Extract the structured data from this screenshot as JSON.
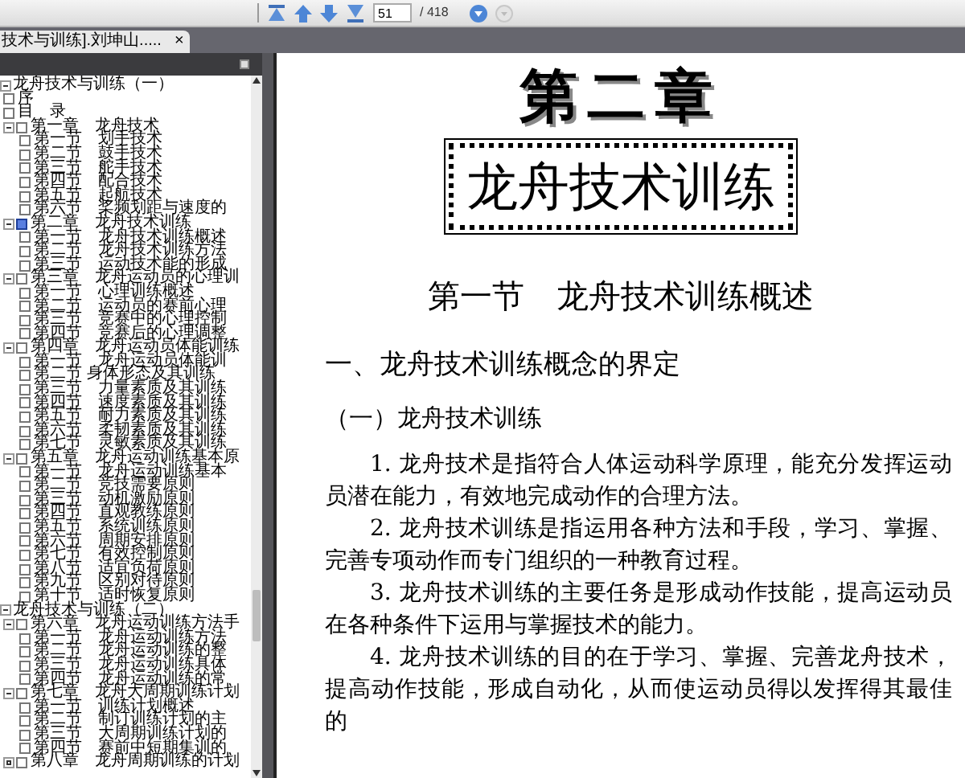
{
  "toolbar": {
    "page_number": "51",
    "page_total": "/ 418"
  },
  "tab": {
    "title": "技术与训练].刘坤山.....",
    "close": "×"
  },
  "outline": [
    {
      "label": "龙舟技术与训练（一）",
      "expanded": true,
      "children": [
        {
          "label": "序",
          "selected": false
        },
        {
          "label": "目　录",
          "selected": false
        },
        {
          "label": "第一章　龙舟技术",
          "selected": false,
          "expanded": true,
          "children": [
            {
              "label": "第一节　划手技术",
              "selected": false
            },
            {
              "label": "第二节　鼓手技术",
              "selected": false
            },
            {
              "label": "第三节　舵手技术",
              "selected": false
            },
            {
              "label": "第四节　配合技术",
              "selected": false
            },
            {
              "label": "第五节　起航技术",
              "selected": false
            },
            {
              "label": "第六节　桨频划距与速度的",
              "selected": false
            }
          ]
        },
        {
          "label": "第二章　龙舟技术训练",
          "selected": true,
          "expanded": true,
          "children": [
            {
              "label": "第一节　龙舟技术训练概述",
              "selected": false
            },
            {
              "label": "第二节　龙舟技术训练方法",
              "selected": false
            },
            {
              "label": "第三节　运动技术能的形成",
              "selected": false
            }
          ]
        },
        {
          "label": "第三章　龙舟运动员的心理训",
          "selected": false,
          "expanded": true,
          "children": [
            {
              "label": "第一节　心理训练概述",
              "selected": false
            },
            {
              "label": "第二节　运动员的赛前心理",
              "selected": false
            },
            {
              "label": "第三节　竞赛中的心理控制",
              "selected": false
            },
            {
              "label": "第四节　竞赛后的心理调整",
              "selected": false
            }
          ]
        },
        {
          "label": "第四章　龙舟运动员体能训练",
          "selected": false,
          "expanded": true,
          "children": [
            {
              "label": "第一节　龙舟运动员体能训",
              "selected": false
            },
            {
              "label": "第二节 身体形态及其训练",
              "selected": false
            },
            {
              "label": "第三节　力量素质及其训练",
              "selected": false
            },
            {
              "label": "第四节　速度素质及其训练",
              "selected": false
            },
            {
              "label": "第五节　耐力素质及其训练",
              "selected": false
            },
            {
              "label": "第六节　柔韧素质及其训练",
              "selected": false
            },
            {
              "label": "第七节　灵敏素质及其训练",
              "selected": false
            }
          ]
        },
        {
          "label": "第五章　龙舟运动训练基本原",
          "selected": false,
          "expanded": true,
          "children": [
            {
              "label": "第一节　龙舟运动训练基本",
              "selected": false
            },
            {
              "label": "第二节　竞技需要原则",
              "selected": false
            },
            {
              "label": "第三节　动机激励原则",
              "selected": false
            },
            {
              "label": "第四节　直观教练原则",
              "selected": false
            },
            {
              "label": "第五节　系统训练原则",
              "selected": false
            },
            {
              "label": "第六节　周期安排原则",
              "selected": false
            },
            {
              "label": "第七节　有效控制原则",
              "selected": false
            },
            {
              "label": "第八节　适宜负荷原则",
              "selected": false
            },
            {
              "label": "第九节　区别对待原则",
              "selected": false
            },
            {
              "label": "第十节　适时恢复原则",
              "selected": false
            }
          ]
        }
      ]
    },
    {
      "label": "龙舟技术与训练（二）",
      "expanded": true,
      "children": [
        {
          "label": "第六章　龙舟运动训练方法手",
          "selected": false,
          "expanded": true,
          "children": [
            {
              "label": "第一节　龙舟运动训练方法",
              "selected": false
            },
            {
              "label": "第二节　龙舟运动训练的整",
              "selected": false
            },
            {
              "label": "第三节　龙舟运动训练具体",
              "selected": false
            },
            {
              "label": "第四节　龙舟运动训练的常",
              "selected": false
            }
          ]
        },
        {
          "label": "第七章　龙舟大周期训练计划",
          "selected": false,
          "expanded": true,
          "children": [
            {
              "label": "第一节　训练计划概述",
              "selected": false
            },
            {
              "label": "第二节　制订训练计划的主",
              "selected": false
            },
            {
              "label": "第三节　大周期训练计划的",
              "selected": false
            },
            {
              "label": "第四节　赛前中短期集训的",
              "selected": false
            }
          ]
        },
        {
          "label": "第八章　龙舟周期训练的计划",
          "selected": false,
          "expanded": false
        }
      ]
    }
  ],
  "page": {
    "chapter": "第二章",
    "title": "龙舟技术训练",
    "section": "第一节　龙舟技术训练概述",
    "heading": "一、龙舟技术训练概念的界定",
    "subheading": "（一）龙舟技术训练",
    "paragraphs": [
      "1. 龙舟技术是指符合人体运动科学原理，能充分发挥运动员潜在能力，有效地完成动作的合理方法。",
      "2. 龙舟技术训练是指运用各种方法和手段，学习、掌握、完善专项动作而专门组织的一种教育过程。",
      "3. 龙舟技术训练的主要任务是形成动作技能，提高运动员在各种条件下运用与掌握技术的能力。",
      "4. 龙舟技术训练的目的在于学习、掌握、完善龙舟技术，提高动作技能，形成自动化，从而使运动员得以发挥得其最佳的"
    ]
  }
}
